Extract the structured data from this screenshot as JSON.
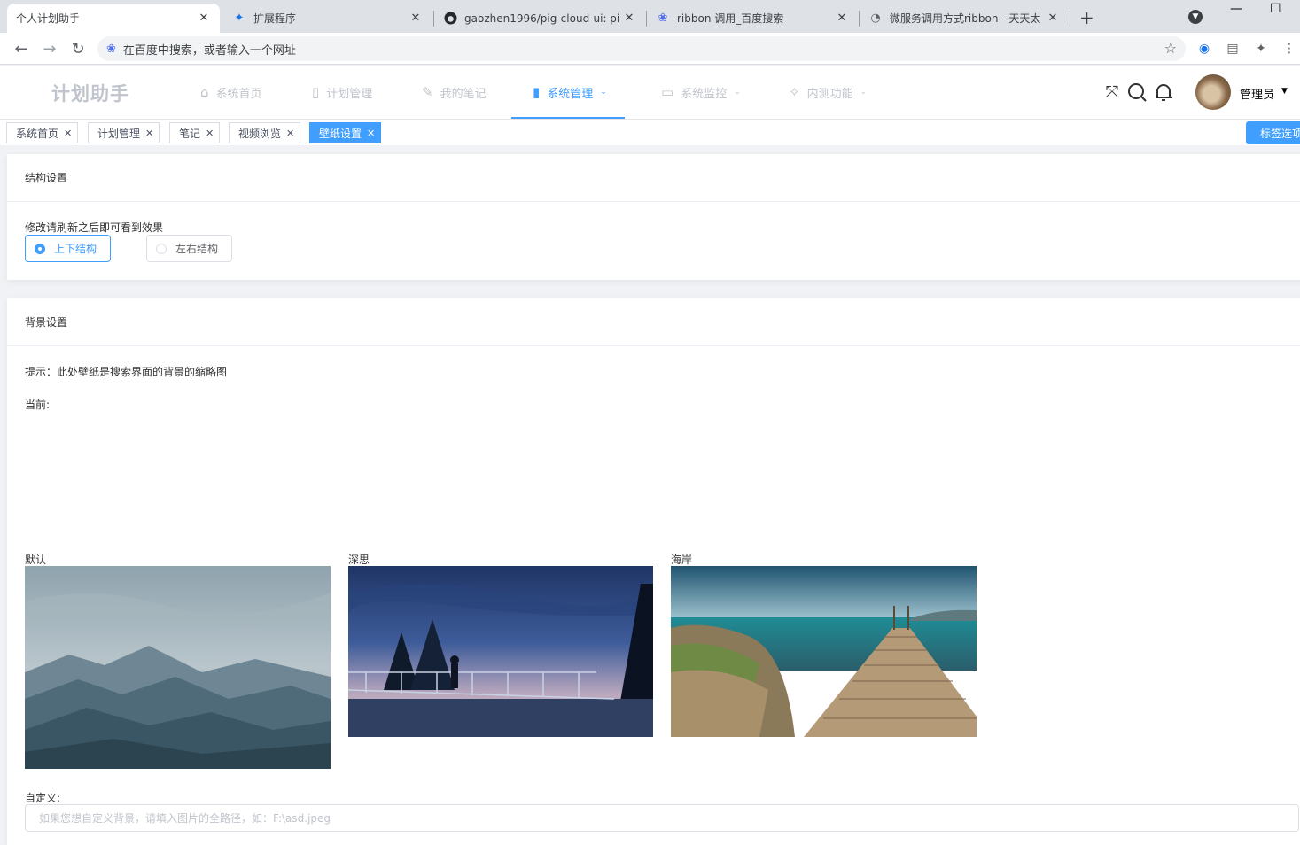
{
  "browser": {
    "tabs": [
      {
        "title": "个人计划助手",
        "active": true
      },
      {
        "title": "扩展程序",
        "active": false
      },
      {
        "title": "gaozhen1996/pig-cloud-ui: pi",
        "active": false
      },
      {
        "title": "ribbon 调用_百度搜索",
        "active": false
      },
      {
        "title": "微服务调用方式ribbon - 天天太",
        "active": false
      }
    ],
    "address_placeholder": "在百度中搜索，或者输入一个网址"
  },
  "app": {
    "brand": "计划助手",
    "menu": [
      {
        "label": "系统首页",
        "icon": "home-icon",
        "dropdown": false,
        "active": false
      },
      {
        "label": "计划管理",
        "icon": "tablet-icon",
        "dropdown": false,
        "active": false
      },
      {
        "label": "我的笔记",
        "icon": "edit-icon",
        "dropdown": false,
        "active": false
      },
      {
        "label": "系统管理",
        "icon": "bars-icon",
        "dropdown": true,
        "active": true
      },
      {
        "label": "系统监控",
        "icon": "monitor-icon",
        "dropdown": true,
        "active": false
      },
      {
        "label": "内测功能",
        "icon": "magic-icon",
        "dropdown": true,
        "active": false
      }
    ],
    "user": "管理员",
    "accent": "#409eff"
  },
  "tags": {
    "items": [
      {
        "label": "系统首页",
        "active": false
      },
      {
        "label": "计划管理",
        "active": false
      },
      {
        "label": "笔记",
        "active": false
      },
      {
        "label": "视频浏览",
        "active": false
      },
      {
        "label": "壁纸设置",
        "active": true
      }
    ],
    "options_label": "标签选项"
  },
  "structure": {
    "title": "结构设置",
    "hint": "修改请刷新之后即可看到效果",
    "options": [
      {
        "label": "上下结构",
        "checked": true
      },
      {
        "label": "左右结构",
        "checked": false
      }
    ]
  },
  "background": {
    "title": "背景设置",
    "tip": "提示：此处壁纸是搜索界面的背景的缩略图",
    "current_label": "当前:",
    "wallpapers": [
      {
        "label": "默认"
      },
      {
        "label": "深思"
      },
      {
        "label": "海岸"
      }
    ],
    "custom_label": "自定义:",
    "custom_placeholder": "如果您想自定义背景，请填入图片的全路径，如：F:\\asd.jpeg"
  }
}
